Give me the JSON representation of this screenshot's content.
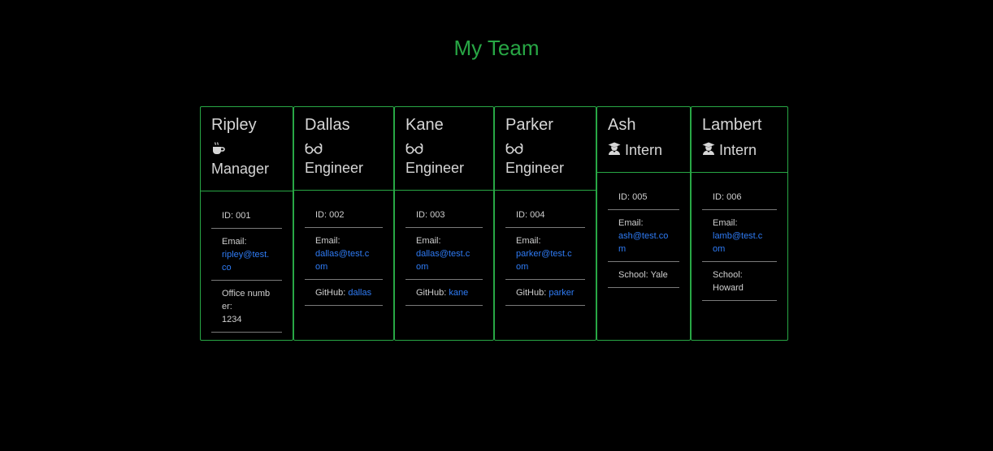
{
  "page": {
    "title": "My Team"
  },
  "colors": {
    "accent": "#28a745",
    "link": "#2f7cf6",
    "background": "#000000"
  },
  "team": [
    {
      "name": "Ripley",
      "role": "Manager",
      "icon": "coffee-icon",
      "id_label": "ID: 001",
      "email_label": "Email:",
      "email": "ripley@test.co",
      "extra_label": "Office number:",
      "extra_value": "1234"
    },
    {
      "name": "Dallas",
      "role": "Engineer",
      "icon": "glasses-icon",
      "id_label": "ID: 002",
      "email_label": "Email:",
      "email": "dallas@test.com",
      "extra_label": "GitHub:",
      "extra_value": "dallas"
    },
    {
      "name": "Kane",
      "role": "Engineer",
      "icon": "glasses-icon",
      "id_label": "ID: 003",
      "email_label": "Email:",
      "email": "dallas@test.com",
      "extra_label": "GitHub:",
      "extra_value": "kane"
    },
    {
      "name": "Parker",
      "role": "Engineer",
      "icon": "glasses-icon",
      "id_label": "ID: 004",
      "email_label": "Email:",
      "email": "parker@test.com",
      "extra_label": "GitHub:",
      "extra_value": "parker"
    },
    {
      "name": "Ash",
      "role": "Intern",
      "icon": "user-graduate-icon",
      "id_label": "ID: 005",
      "email_label": "Email:",
      "email": "ash@test.com",
      "extra_label": "School:",
      "extra_value": "Yale"
    },
    {
      "name": "Lambert",
      "role": "Intern",
      "icon": "user-graduate-icon",
      "id_label": "ID: 006",
      "email_label": "Email:",
      "email": "lamb@test.com",
      "extra_label": "School:",
      "extra_value": "Howard"
    }
  ]
}
